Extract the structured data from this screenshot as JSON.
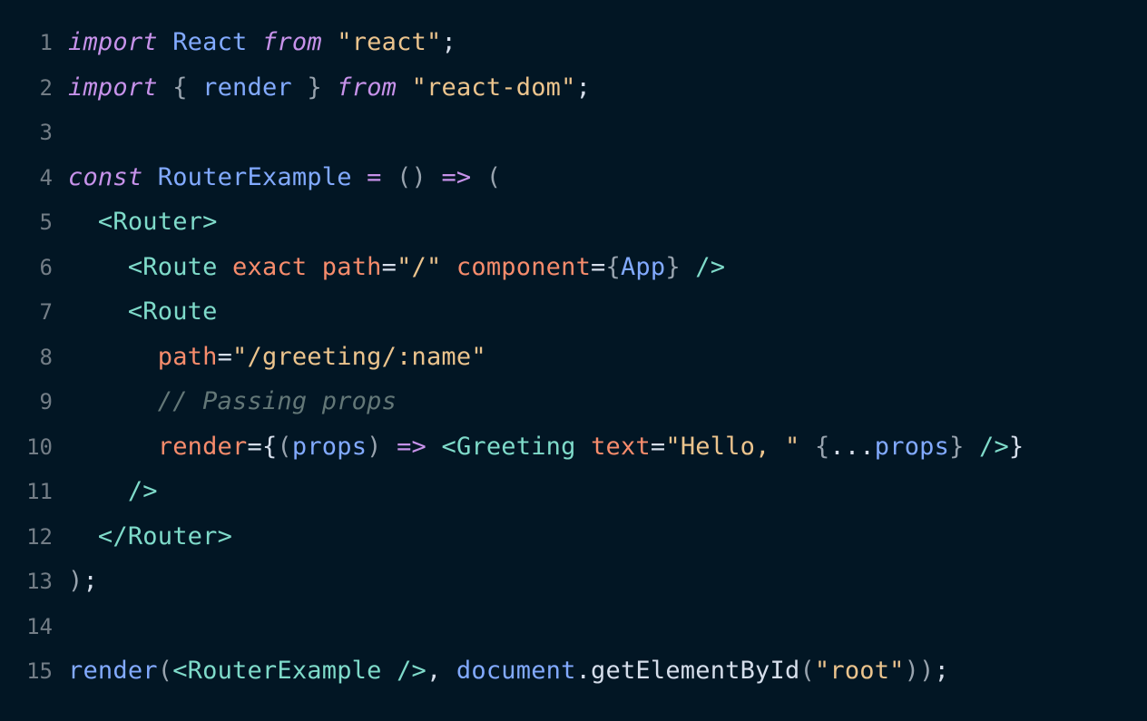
{
  "editor": {
    "lines": [
      {
        "number": "1",
        "tokens": [
          {
            "text": "import",
            "kind": "keyword"
          },
          {
            "text": " ",
            "kind": "plain"
          },
          {
            "text": "React",
            "kind": "identifier"
          },
          {
            "text": " ",
            "kind": "plain"
          },
          {
            "text": "from",
            "kind": "keyword"
          },
          {
            "text": " ",
            "kind": "plain"
          },
          {
            "text": "\"react\"",
            "kind": "string"
          },
          {
            "text": ";",
            "kind": "punct"
          }
        ]
      },
      {
        "number": "2",
        "tokens": [
          {
            "text": "import",
            "kind": "keyword"
          },
          {
            "text": " ",
            "kind": "plain"
          },
          {
            "text": "{",
            "kind": "muted"
          },
          {
            "text": " ",
            "kind": "plain"
          },
          {
            "text": "render",
            "kind": "identifier"
          },
          {
            "text": " ",
            "kind": "plain"
          },
          {
            "text": "}",
            "kind": "muted"
          },
          {
            "text": " ",
            "kind": "plain"
          },
          {
            "text": "from",
            "kind": "keyword"
          },
          {
            "text": " ",
            "kind": "plain"
          },
          {
            "text": "\"react-dom\"",
            "kind": "string"
          },
          {
            "text": ";",
            "kind": "punct"
          }
        ]
      },
      {
        "number": "3",
        "tokens": []
      },
      {
        "number": "4",
        "tokens": [
          {
            "text": "const",
            "kind": "keyword"
          },
          {
            "text": " ",
            "kind": "plain"
          },
          {
            "text": "RouterExample",
            "kind": "identifier"
          },
          {
            "text": " ",
            "kind": "plain"
          },
          {
            "text": "=",
            "kind": "operator"
          },
          {
            "text": " ",
            "kind": "plain"
          },
          {
            "text": "()",
            "kind": "muted"
          },
          {
            "text": " ",
            "kind": "plain"
          },
          {
            "text": "=>",
            "kind": "operator"
          },
          {
            "text": " ",
            "kind": "plain"
          },
          {
            "text": "(",
            "kind": "muted"
          }
        ]
      },
      {
        "number": "5",
        "tokens": [
          {
            "text": "  ",
            "kind": "plain"
          },
          {
            "text": "<Router>",
            "kind": "tag"
          }
        ]
      },
      {
        "number": "6",
        "tokens": [
          {
            "text": "    ",
            "kind": "plain"
          },
          {
            "text": "<Route",
            "kind": "tag"
          },
          {
            "text": " ",
            "kind": "plain"
          },
          {
            "text": "exact",
            "kind": "attr"
          },
          {
            "text": " ",
            "kind": "plain"
          },
          {
            "text": "path",
            "kind": "attr"
          },
          {
            "text": "=",
            "kind": "plain"
          },
          {
            "text": "\"/\"",
            "kind": "string"
          },
          {
            "text": " ",
            "kind": "plain"
          },
          {
            "text": "component",
            "kind": "attr"
          },
          {
            "text": "=",
            "kind": "plain"
          },
          {
            "text": "{",
            "kind": "muted"
          },
          {
            "text": "App",
            "kind": "identifier"
          },
          {
            "text": "}",
            "kind": "muted"
          },
          {
            "text": " ",
            "kind": "plain"
          },
          {
            "text": "/>",
            "kind": "tag"
          }
        ]
      },
      {
        "number": "7",
        "tokens": [
          {
            "text": "    ",
            "kind": "plain"
          },
          {
            "text": "<Route",
            "kind": "tag"
          }
        ]
      },
      {
        "number": "8",
        "tokens": [
          {
            "text": "      ",
            "kind": "plain"
          },
          {
            "text": "path",
            "kind": "attr"
          },
          {
            "text": "=",
            "kind": "plain"
          },
          {
            "text": "\"/greeting/:name\"",
            "kind": "string"
          }
        ]
      },
      {
        "number": "9",
        "tokens": [
          {
            "text": "      ",
            "kind": "plain"
          },
          {
            "text": "// Passing props",
            "kind": "comment"
          }
        ]
      },
      {
        "number": "10",
        "tokens": [
          {
            "text": "      ",
            "kind": "plain"
          },
          {
            "text": "render",
            "kind": "attr"
          },
          {
            "text": "=",
            "kind": "plain"
          },
          {
            "text": "{",
            "kind": "plain"
          },
          {
            "text": "(",
            "kind": "muted"
          },
          {
            "text": "props",
            "kind": "identifier"
          },
          {
            "text": ")",
            "kind": "muted"
          },
          {
            "text": " ",
            "kind": "plain"
          },
          {
            "text": "=>",
            "kind": "operator"
          },
          {
            "text": " ",
            "kind": "plain"
          },
          {
            "text": "<Greeting",
            "kind": "tag"
          },
          {
            "text": " ",
            "kind": "plain"
          },
          {
            "text": "text",
            "kind": "attr"
          },
          {
            "text": "=",
            "kind": "plain"
          },
          {
            "text": "\"Hello, \"",
            "kind": "string"
          },
          {
            "text": " ",
            "kind": "plain"
          },
          {
            "text": "{",
            "kind": "muted"
          },
          {
            "text": "...",
            "kind": "plain"
          },
          {
            "text": "props",
            "kind": "identifier"
          },
          {
            "text": "}",
            "kind": "muted"
          },
          {
            "text": " ",
            "kind": "plain"
          },
          {
            "text": "/>",
            "kind": "tag"
          },
          {
            "text": "}",
            "kind": "plain"
          }
        ]
      },
      {
        "number": "11",
        "tokens": [
          {
            "text": "    ",
            "kind": "plain"
          },
          {
            "text": "/>",
            "kind": "tag"
          }
        ]
      },
      {
        "number": "12",
        "tokens": [
          {
            "text": "  ",
            "kind": "plain"
          },
          {
            "text": "</Router>",
            "kind": "tag"
          }
        ]
      },
      {
        "number": "13",
        "tokens": [
          {
            "text": ")",
            "kind": "muted"
          },
          {
            "text": ";",
            "kind": "punct"
          }
        ]
      },
      {
        "number": "14",
        "tokens": []
      },
      {
        "number": "15",
        "tokens": [
          {
            "text": "render",
            "kind": "identifier"
          },
          {
            "text": "(",
            "kind": "muted"
          },
          {
            "text": "<RouterExample",
            "kind": "tag"
          },
          {
            "text": " ",
            "kind": "plain"
          },
          {
            "text": "/>",
            "kind": "tag"
          },
          {
            "text": ",",
            "kind": "punct"
          },
          {
            "text": " ",
            "kind": "plain"
          },
          {
            "text": "document",
            "kind": "identifier"
          },
          {
            "text": ".",
            "kind": "punct"
          },
          {
            "text": "getElementById",
            "kind": "plain"
          },
          {
            "text": "(",
            "kind": "muted"
          },
          {
            "text": "\"root\"",
            "kind": "string"
          },
          {
            "text": "))",
            "kind": "muted"
          },
          {
            "text": ";",
            "kind": "punct"
          }
        ]
      }
    ]
  },
  "colors": {
    "background": "#021624",
    "line_number": "#737d86",
    "keyword": "#c792ea",
    "identifier": "#82aaff",
    "string": "#ecc48d",
    "tag": "#7fdbca",
    "attribute": "#f78c6c",
    "comment": "#637777",
    "punctuation": "#d6deeb"
  }
}
